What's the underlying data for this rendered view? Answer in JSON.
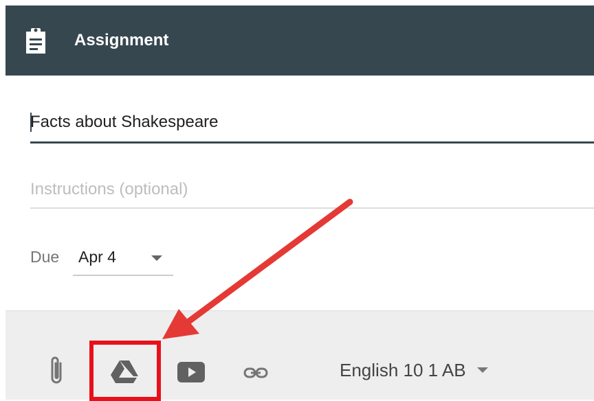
{
  "header": {
    "title": "Assignment",
    "icon": "clipboard-icon"
  },
  "form": {
    "title_value": "Facts about Shakespeare",
    "instructions_placeholder": "Instructions (optional)",
    "due_label": "Due",
    "due_value": "Apr 4"
  },
  "toolbar": {
    "icons": [
      "paperclip-icon",
      "google-drive-icon",
      "youtube-icon",
      "link-icon"
    ],
    "course_value": "English 10 1 AB"
  },
  "annotation": {
    "color": "#e53935",
    "highlight_color": "#e8101a",
    "target": "google-drive-icon"
  }
}
